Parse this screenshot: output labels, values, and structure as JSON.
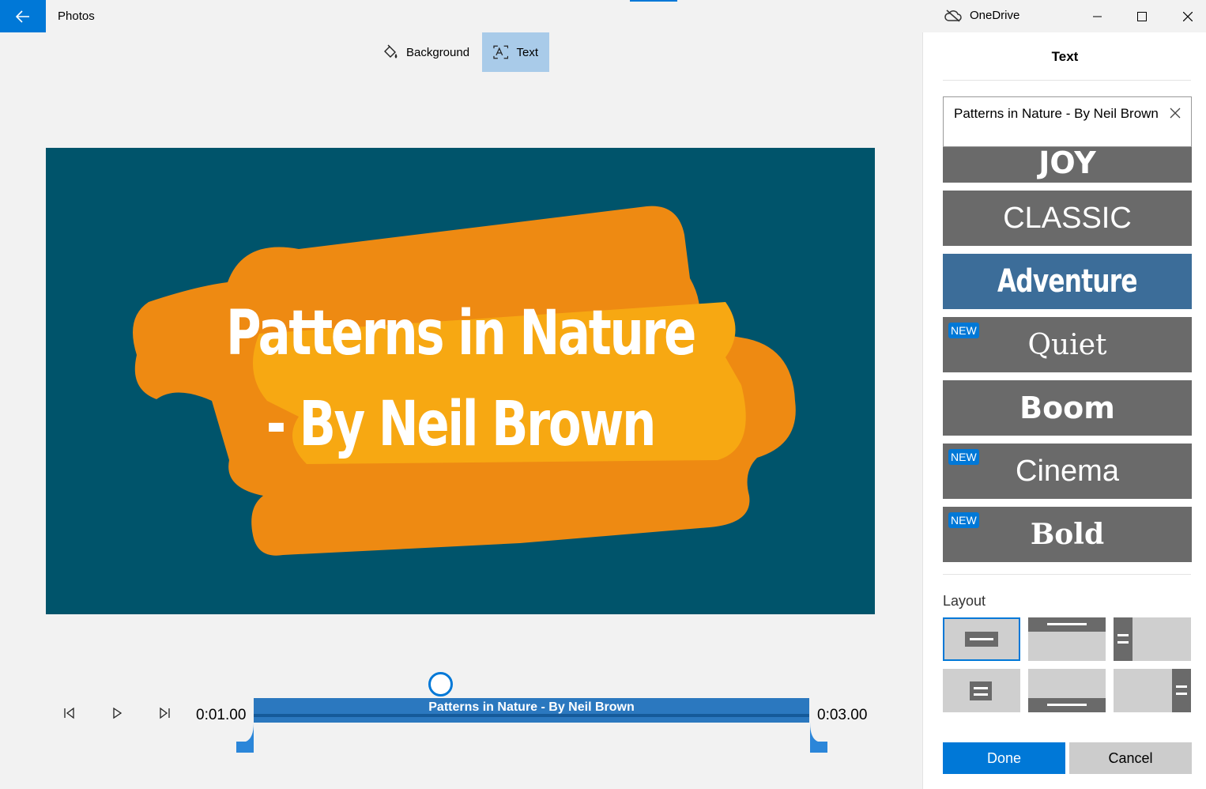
{
  "app": {
    "title": "Photos",
    "onedrive_label": "OneDrive"
  },
  "toolbar": {
    "background_label": "Background",
    "text_label": "Text"
  },
  "preview": {
    "line1": "Patterns in Nature",
    "line2": "- By Neil Brown"
  },
  "playback": {
    "start_time": "0:01.00",
    "end_time": "0:03.00",
    "track_label": "Patterns in Nature  - By Neil Brown"
  },
  "panel": {
    "title": "Text",
    "text_value": "Patterns in Nature  - By Neil Brown",
    "styles": [
      {
        "label": "JOY",
        "new": false,
        "selected": false
      },
      {
        "label": "CLASSIC",
        "new": false,
        "selected": false
      },
      {
        "label": "Adventure",
        "new": false,
        "selected": true
      },
      {
        "label": "Quiet",
        "new": true,
        "selected": false
      },
      {
        "label": "Boom",
        "new": false,
        "selected": false
      },
      {
        "label": "Cinema",
        "new": true,
        "selected": false
      },
      {
        "label": "Bold",
        "new": true,
        "selected": false
      }
    ],
    "new_badge": "NEW",
    "layout_label": "Layout",
    "done_label": "Done",
    "cancel_label": "Cancel"
  },
  "colors": {
    "accent": "#0078d7",
    "preview_bg": "#00546b",
    "brush": "#ee8a12",
    "style_card": "#6a6a6a",
    "style_selected": "#3c6d99"
  }
}
